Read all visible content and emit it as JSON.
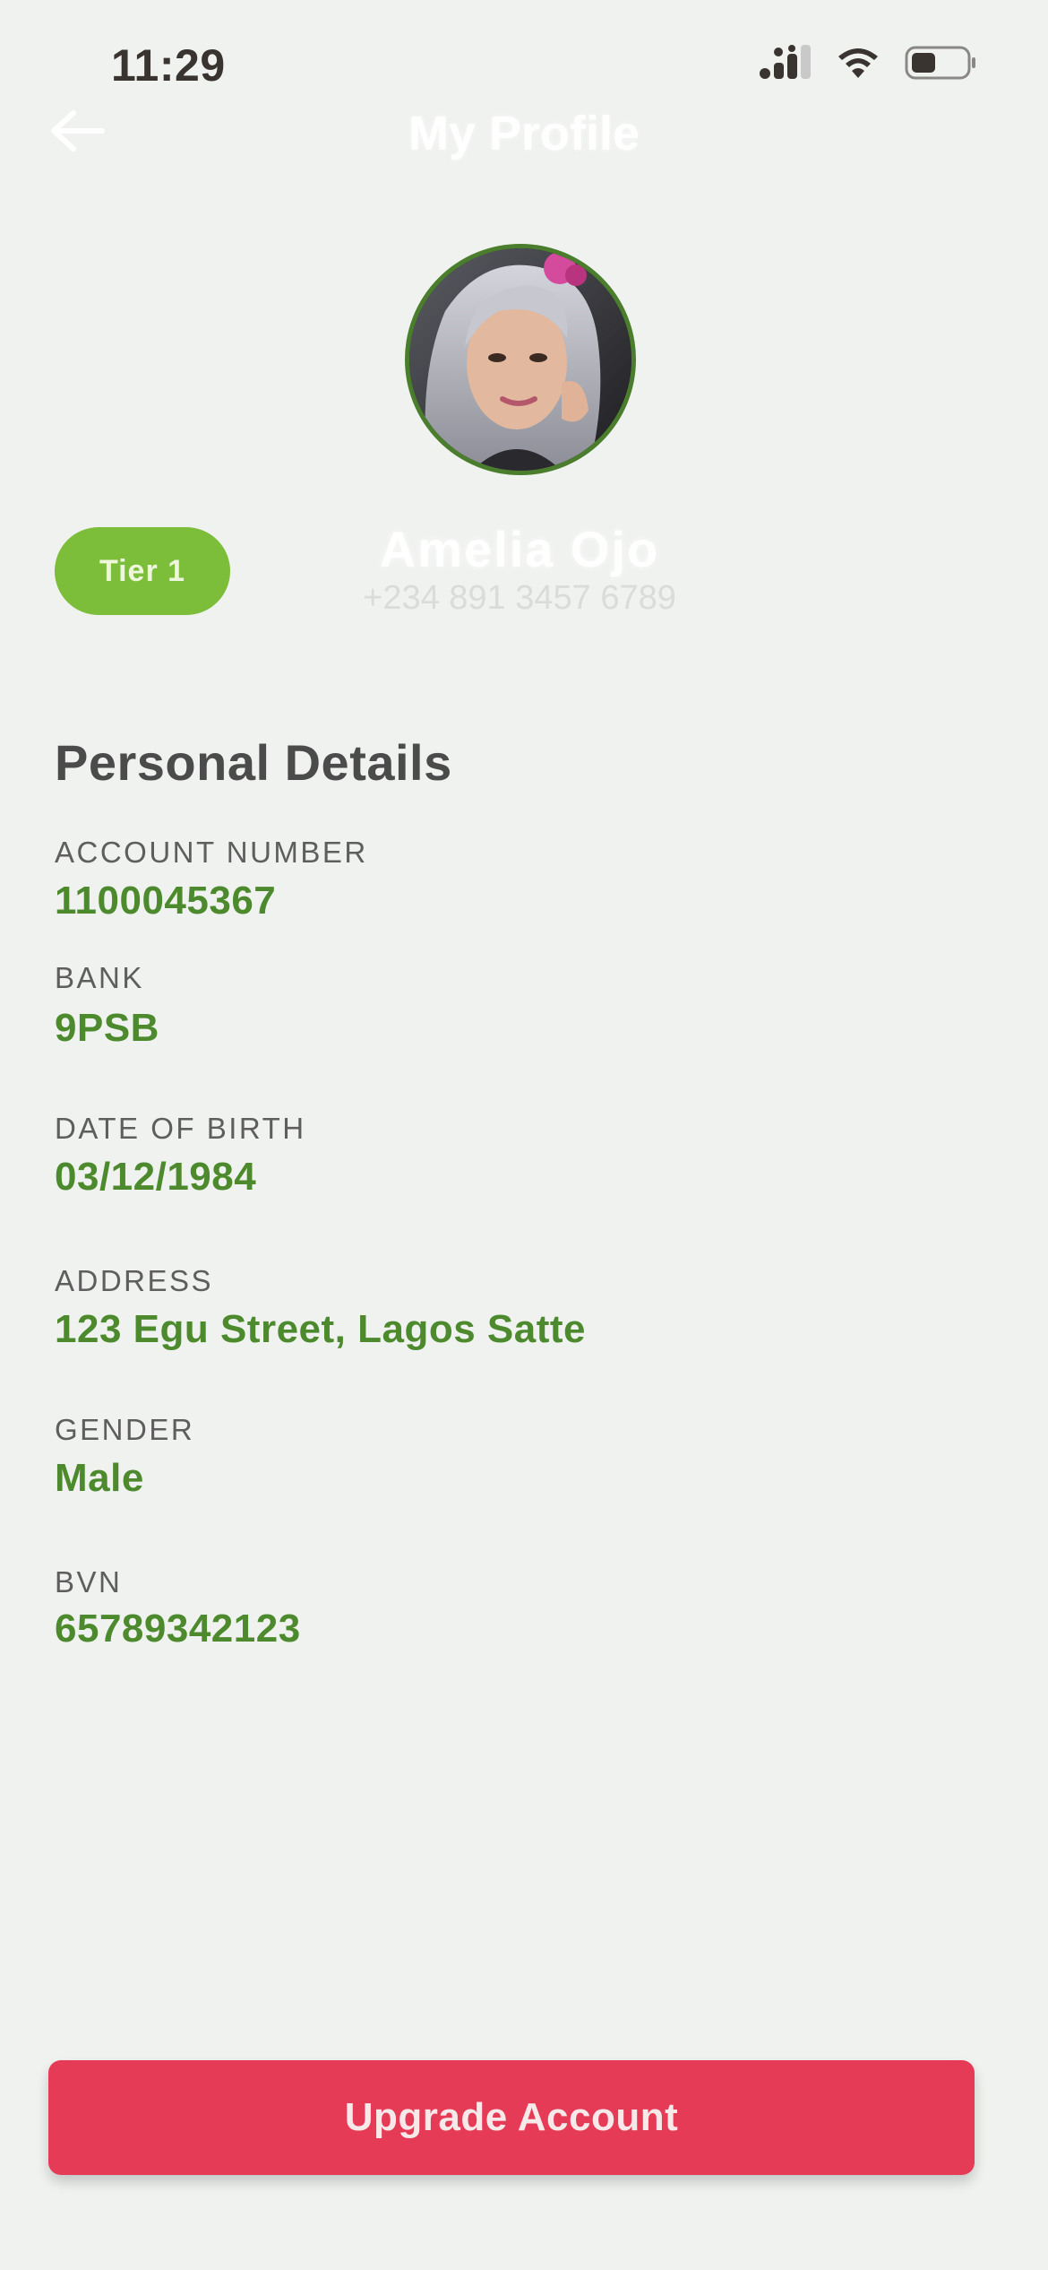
{
  "status_bar": {
    "time": "11:29",
    "icons": [
      "cellular-signal-icon",
      "wifi-icon",
      "battery-icon"
    ]
  },
  "header": {
    "title": "My Profile",
    "back_icon": "back-arrow-icon"
  },
  "profile": {
    "tier": "Tier 1",
    "name": "Amelia Ojo",
    "phone": "+234 891 3457 6789"
  },
  "personal_details": {
    "title": "Personal Details",
    "fields": [
      {
        "label": "ACCOUNT NUMBER",
        "value": "1100045367"
      },
      {
        "label": "BANK",
        "value": "9PSB"
      },
      {
        "label": "DATE OF BIRTH",
        "value": "03/12/1984"
      },
      {
        "label": "ADDRESS",
        "value": "123 Egu Street,  Lagos Satte"
      },
      {
        "label": "GENDER",
        "value": "Male"
      },
      {
        "label": "BVN",
        "value": "65789342123"
      }
    ]
  },
  "actions": {
    "upgrade_label": "Upgrade Account"
  },
  "colors": {
    "background": "#f0f2ef",
    "accent_green": "#4c8a2d",
    "tier_green": "#7cbd3a",
    "primary_button": "#e63b57"
  }
}
